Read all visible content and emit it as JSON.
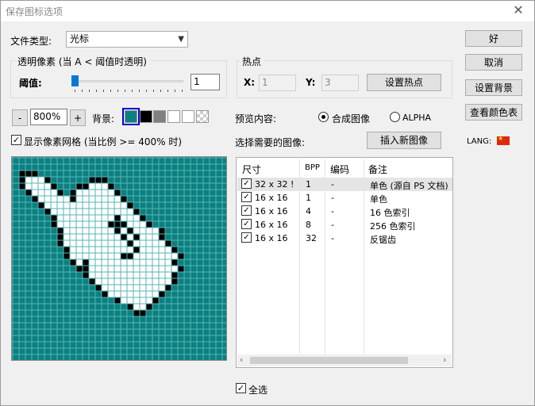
{
  "window": {
    "title": "保存图标选项",
    "close_glyph": "✕"
  },
  "file_type": {
    "label": "文件类型:",
    "value": "光标"
  },
  "transparency": {
    "group_label": "透明像素 (当 A < 阈值时透明)",
    "threshold_label": "阈值:",
    "threshold_value": "1"
  },
  "hotspot": {
    "group_label": "热点",
    "x_label": "X:",
    "x_value": "1",
    "y_label": "Y:",
    "y_value": "3",
    "set_button": "设置热点"
  },
  "zoom": {
    "minus": "-",
    "value": "800%",
    "plus": "+"
  },
  "background": {
    "label": "背景:",
    "swatches": [
      "#0b8080",
      "#000000",
      "#808080",
      "#ffffff",
      "#ffffff",
      "checker"
    ]
  },
  "grid": {
    "label": "显示像素网格 (当比例 >= 400% 时)"
  },
  "preview": {
    "label": "预览内容:",
    "option1": "合成图像",
    "option2": "ALPHA"
  },
  "select": {
    "label": "选择需要的图像:",
    "insert_button": "插入新图像"
  },
  "list": {
    "headers": [
      "尺寸",
      "BPP",
      "编码",
      "备注"
    ],
    "rows": [
      {
        "size": "32 x 32 !",
        "bpp": "1",
        "enc": "-",
        "note": "单色 (源自 PS 文档)"
      },
      {
        "size": "16 x 16",
        "bpp": "1",
        "enc": "-",
        "note": "单色"
      },
      {
        "size": "16 x 16",
        "bpp": "4",
        "enc": "-",
        "note": "16 色索引"
      },
      {
        "size": "16 x 16",
        "bpp": "8",
        "enc": "-",
        "note": "256 色索引"
      },
      {
        "size": "16 x 16",
        "bpp": "32",
        "enc": "-",
        "note": "反锯齿"
      }
    ]
  },
  "select_all": "全选",
  "buttons": {
    "ok": "好",
    "cancel": "取消",
    "set_bg": "设置背景",
    "palette": "查看颜色表"
  },
  "lang": "LANG:",
  "check_mark": "✓",
  "scroll_left": "‹",
  "scroll_right": "›",
  "colors": {
    "accent": "#0b8080",
    "grid": "#5ab4b4"
  }
}
